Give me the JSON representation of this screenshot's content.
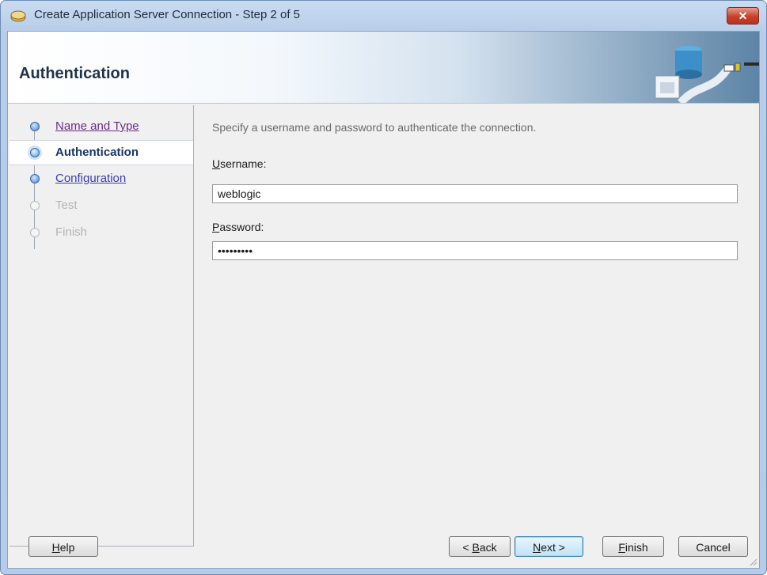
{
  "window": {
    "title": "Create Application Server Connection - Step 2 of 5",
    "close_label": "✕"
  },
  "banner": {
    "title": "Authentication"
  },
  "steps": [
    {
      "label": "Name and Type",
      "state": "done"
    },
    {
      "label": "Authentication",
      "state": "active"
    },
    {
      "label": "Configuration",
      "state": "link"
    },
    {
      "label": "Test",
      "state": "disabled"
    },
    {
      "label": "Finish",
      "state": "disabled"
    }
  ],
  "form": {
    "instruction": "Specify a username and password to authenticate the connection.",
    "username_label_mnemonic": "U",
    "username_label_rest": "sername:",
    "username_value": "weblogic",
    "password_label_mnemonic": "P",
    "password_label_rest": "assword:",
    "password_value": "weblogic1"
  },
  "buttons": {
    "help_mnemonic": "H",
    "help_rest": "elp",
    "back_prefix": "< ",
    "back_mnemonic": "B",
    "back_rest": "ack",
    "next_mnemonic": "N",
    "next_rest": "ext >",
    "finish_mnemonic": "F",
    "finish_rest": "inish",
    "cancel": "Cancel"
  },
  "colors": {
    "accent": "#3c7fb1",
    "close": "#c8402b",
    "active_step_text": "#16366b"
  }
}
